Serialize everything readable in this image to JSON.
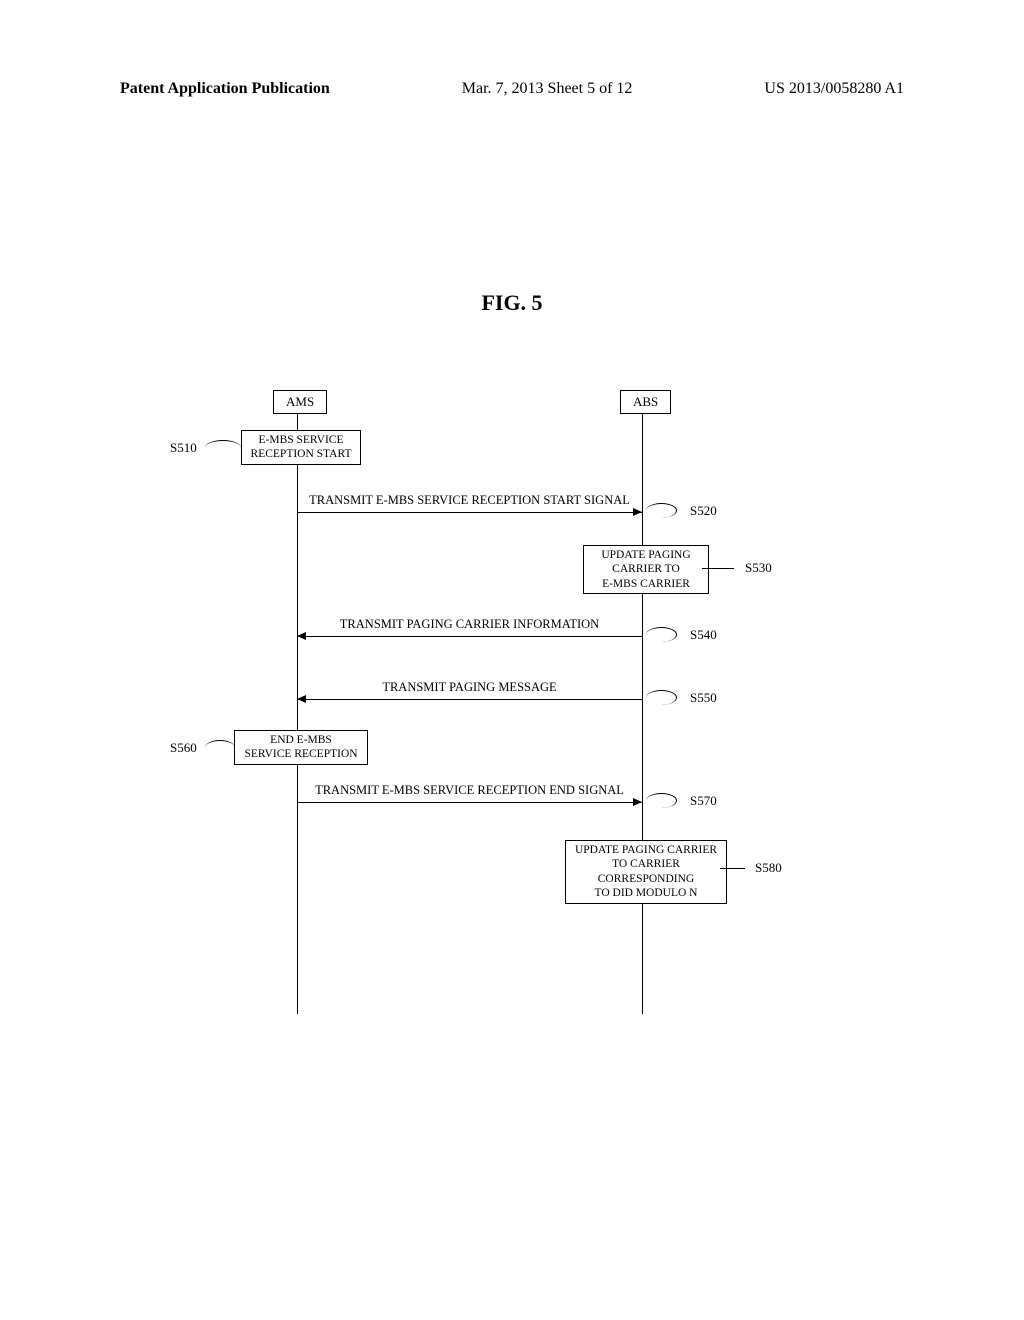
{
  "header": {
    "left": "Patent Application Publication",
    "middle": "Mar. 7, 2013  Sheet 5 of 12",
    "right": "US 2013/0058280 A1"
  },
  "figure_title": "FIG.  5",
  "actors": {
    "ams": "AMS",
    "abs": "ABS"
  },
  "steps": {
    "s510": {
      "ref": "S510",
      "text": "E-MBS SERVICE\nRECEPTION START"
    },
    "s520": {
      "ref": "S520",
      "text": "TRANSMIT E-MBS SERVICE RECEPTION START SIGNAL"
    },
    "s530": {
      "ref": "S530",
      "text": "UPDATE PAGING\nCARRIER TO\nE-MBS CARRIER"
    },
    "s540": {
      "ref": "S540",
      "text": "TRANSMIT PAGING CARRIER INFORMATION"
    },
    "s550": {
      "ref": "S550",
      "text": "TRANSMIT PAGING MESSAGE"
    },
    "s560": {
      "ref": "S560",
      "text": "END E-MBS\nSERVICE RECEPTION"
    },
    "s570": {
      "ref": "S570",
      "text": "TRANSMIT E-MBS SERVICE RECEPTION END SIGNAL"
    },
    "s580": {
      "ref": "S580",
      "text": "UPDATE PAGING CARRIER\nTO CARRIER\nCORRESPONDING\nTO DID MODULO N"
    }
  },
  "chart_data": {
    "type": "sequence-diagram",
    "actors": [
      "AMS",
      "ABS"
    ],
    "events": [
      {
        "id": "S510",
        "at": "AMS",
        "kind": "action",
        "label": "E-MBS SERVICE RECEPTION START"
      },
      {
        "id": "S520",
        "from": "AMS",
        "to": "ABS",
        "kind": "message",
        "label": "TRANSMIT E-MBS SERVICE RECEPTION START SIGNAL"
      },
      {
        "id": "S530",
        "at": "ABS",
        "kind": "action",
        "label": "UPDATE PAGING CARRIER TO E-MBS CARRIER"
      },
      {
        "id": "S540",
        "from": "ABS",
        "to": "AMS",
        "kind": "message",
        "label": "TRANSMIT PAGING CARRIER INFORMATION"
      },
      {
        "id": "S550",
        "from": "ABS",
        "to": "AMS",
        "kind": "message",
        "label": "TRANSMIT PAGING MESSAGE"
      },
      {
        "id": "S560",
        "at": "AMS",
        "kind": "action",
        "label": "END E-MBS SERVICE RECEPTION"
      },
      {
        "id": "S570",
        "from": "AMS",
        "to": "ABS",
        "kind": "message",
        "label": "TRANSMIT E-MBS SERVICE RECEPTION END SIGNAL"
      },
      {
        "id": "S580",
        "at": "ABS",
        "kind": "action",
        "label": "UPDATE PAGING CARRIER TO CARRIER CORRESPONDING TO DID MODULO N"
      }
    ]
  }
}
